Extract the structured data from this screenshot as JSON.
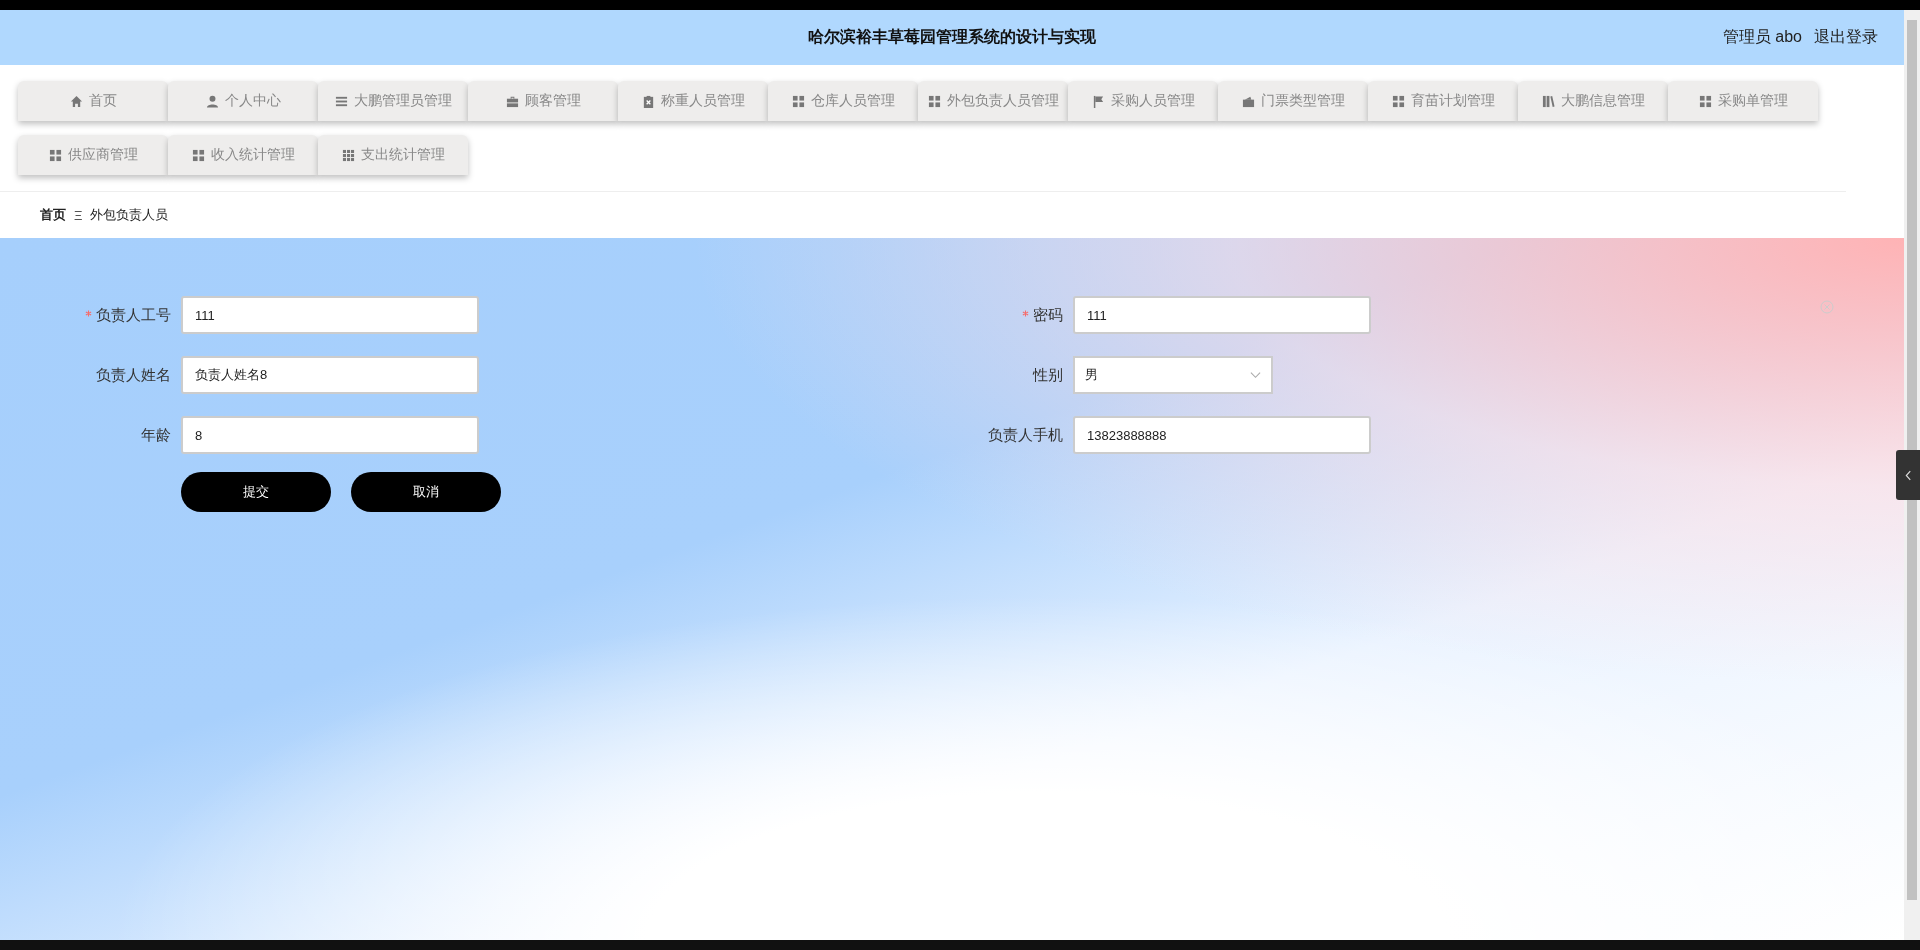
{
  "header": {
    "title": "哈尔滨裕丰草莓园管理系统的设计与实现",
    "user": "管理员 abo",
    "logout": "退出登录"
  },
  "nav": [
    {
      "label": "首页",
      "kind": "home"
    },
    {
      "label": "个人中心",
      "kind": "user"
    },
    {
      "label": "大鹏管理员管理",
      "kind": "list"
    },
    {
      "label": "顾客管理",
      "kind": "briefcase"
    },
    {
      "label": "称重人员管理",
      "kind": "clipboard"
    },
    {
      "label": "仓库人员管理",
      "kind": "grid"
    },
    {
      "label": "外包负责人员管理",
      "kind": "grid"
    },
    {
      "label": "采购人员管理",
      "kind": "flag"
    },
    {
      "label": "门票类型管理",
      "kind": "wallet"
    },
    {
      "label": "育苗计划管理",
      "kind": "grid"
    },
    {
      "label": "大鹏信息管理",
      "kind": "book"
    },
    {
      "label": "采购单管理",
      "kind": "grid"
    },
    {
      "label": "供应商管理",
      "kind": "grid"
    },
    {
      "label": "收入统计管理",
      "kind": "grid"
    },
    {
      "label": "支出统计管理",
      "kind": "grid9"
    }
  ],
  "breadcrumb": {
    "home": "首页",
    "separator": "Ξ",
    "current": "外包负责人员"
  },
  "form": {
    "left": [
      {
        "label": "负责人工号",
        "required": true,
        "kind": "text",
        "value": "111"
      },
      {
        "label": "负责人姓名",
        "required": false,
        "kind": "text",
        "value": "负责人姓名8"
      },
      {
        "label": "年龄",
        "required": false,
        "kind": "text",
        "value": "8"
      }
    ],
    "right": [
      {
        "label": "密码",
        "required": true,
        "kind": "text",
        "value": "111"
      },
      {
        "label": "性别",
        "required": false,
        "kind": "select",
        "value": "男"
      },
      {
        "label": "负责人手机",
        "required": false,
        "kind": "text",
        "value": "13823888888"
      }
    ],
    "buttons": [
      "提交",
      "取消"
    ]
  }
}
